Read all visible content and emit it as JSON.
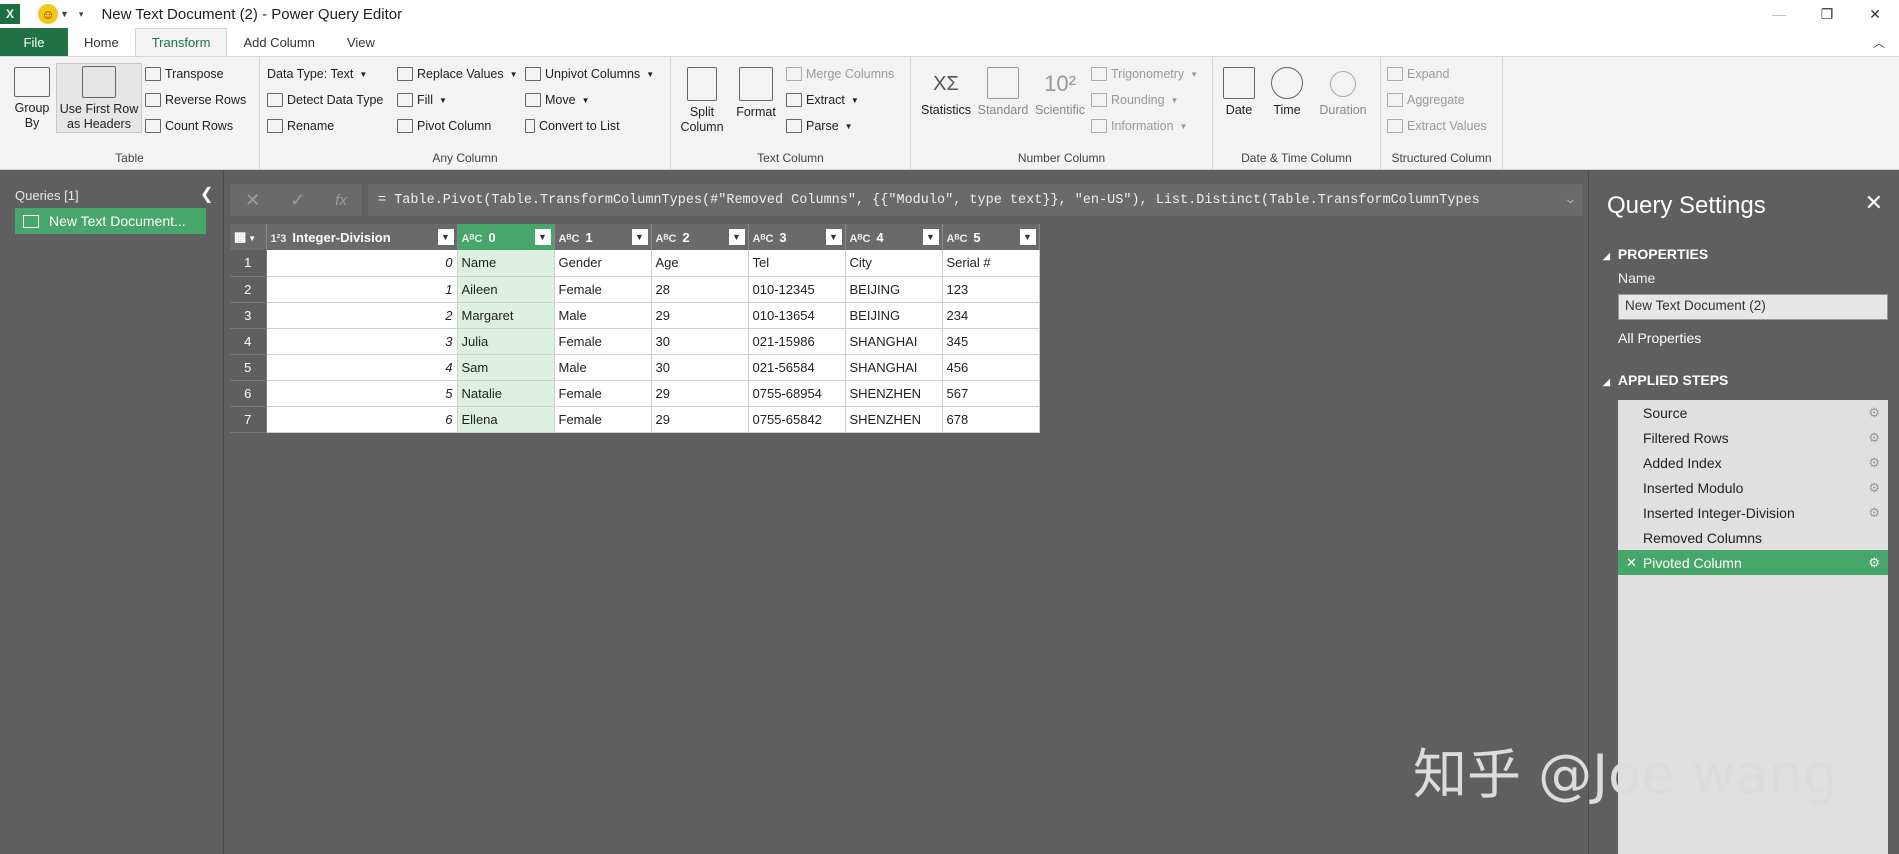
{
  "titlebar": {
    "app_icon": "X",
    "quick_access_icon": "smiley-icon",
    "title": "New Text Document (2) - Power Query Editor",
    "restore": "❐",
    "close": "✕",
    "minimize": "—"
  },
  "tabs": {
    "file": "File",
    "home": "Home",
    "transform": "Transform",
    "add_column": "Add Column",
    "view": "View"
  },
  "ribbon": {
    "table": {
      "label": "Table",
      "group_by": "Group\nBy",
      "use_first_row": "Use First Row\nas Headers",
      "transpose": "Transpose",
      "reverse_rows": "Reverse Rows",
      "count_rows": "Count Rows"
    },
    "any_column": {
      "label": "Any Column",
      "data_type": "Data Type: Text",
      "detect_data_type": "Detect Data Type",
      "rename": "Rename",
      "replace_values": "Replace Values",
      "fill": "Fill",
      "pivot_column": "Pivot Column",
      "unpivot_columns": "Unpivot Columns",
      "move": "Move",
      "convert_to_list": "Convert to List"
    },
    "text_column": {
      "label": "Text Column",
      "split_column": "Split\nColumn",
      "format": "Format",
      "merge_columns": "Merge Columns",
      "extract": "Extract",
      "parse": "Parse"
    },
    "number_column": {
      "label": "Number Column",
      "statistics": "Statistics",
      "standard": "Standard",
      "scientific": "Scientific",
      "trigonometry": "Trigonometry",
      "rounding": "Rounding",
      "information": "Information",
      "sci_glyph": "10²",
      "stat_glyph": "XΣ"
    },
    "datetime_column": {
      "label": "Date & Time Column",
      "date": "Date",
      "time": "Time",
      "duration": "Duration"
    },
    "structured_column": {
      "label": "Structured Column",
      "expand": "Expand",
      "aggregate": "Aggregate",
      "extract_values": "Extract Values"
    }
  },
  "queries": {
    "header": "Queries [1]",
    "item": "New Text Document..."
  },
  "formula_bar": {
    "cancel": "✕",
    "confirm": "✓",
    "fx": "fx",
    "formula": "= Table.Pivot(Table.TransformColumnTypes(#\"Removed Columns\", {{\"Modulo\", type text}}, \"en-US\"), List.Distinct(Table.TransformColumnTypes"
  },
  "grid": {
    "columns": [
      {
        "type": "1²3",
        "name": "Integer-Division"
      },
      {
        "type": "AᴮC",
        "name": "0"
      },
      {
        "type": "AᴮC",
        "name": "1"
      },
      {
        "type": "AᴮC",
        "name": "2"
      },
      {
        "type": "AᴮC",
        "name": "3"
      },
      {
        "type": "AᴮC",
        "name": "4"
      },
      {
        "type": "AᴮC",
        "name": "5"
      }
    ],
    "rows": [
      [
        "1",
        "0",
        "Name",
        "Gender",
        "Age",
        "Tel",
        "City",
        "Serial #"
      ],
      [
        "2",
        "1",
        "Aileen",
        "Female",
        "28",
        "010-12345",
        "BEIJING",
        "123"
      ],
      [
        "3",
        "2",
        "Margaret",
        "Male",
        "29",
        "010-13654",
        "BEIJING",
        "234"
      ],
      [
        "4",
        "3",
        "Julia",
        "Female",
        "30",
        "021-15986",
        "SHANGHAI",
        "345"
      ],
      [
        "5",
        "4",
        "Sam",
        "Male",
        "30",
        "021-56584",
        "SHANGHAI",
        "456"
      ],
      [
        "6",
        "5",
        "Natalie",
        "Female",
        "29",
        "0755-68954",
        "SHENZHEN",
        "567"
      ],
      [
        "7",
        "6",
        "Ellena",
        "Female",
        "29",
        "0755-65842",
        "SHENZHEN",
        "678"
      ]
    ]
  },
  "settings": {
    "title": "Query Settings",
    "close": "✕",
    "properties": "PROPERTIES",
    "name_label": "Name",
    "name_value": "New Text Document (2)",
    "all_properties": "All Properties",
    "applied_steps": "APPLIED STEPS",
    "steps": [
      "Source",
      "Filtered Rows",
      "Added Index",
      "Inserted Modulo",
      "Inserted Integer-Division",
      "Removed Columns",
      "Pivoted Column"
    ]
  },
  "watermark": "知乎 @Joe wang"
}
